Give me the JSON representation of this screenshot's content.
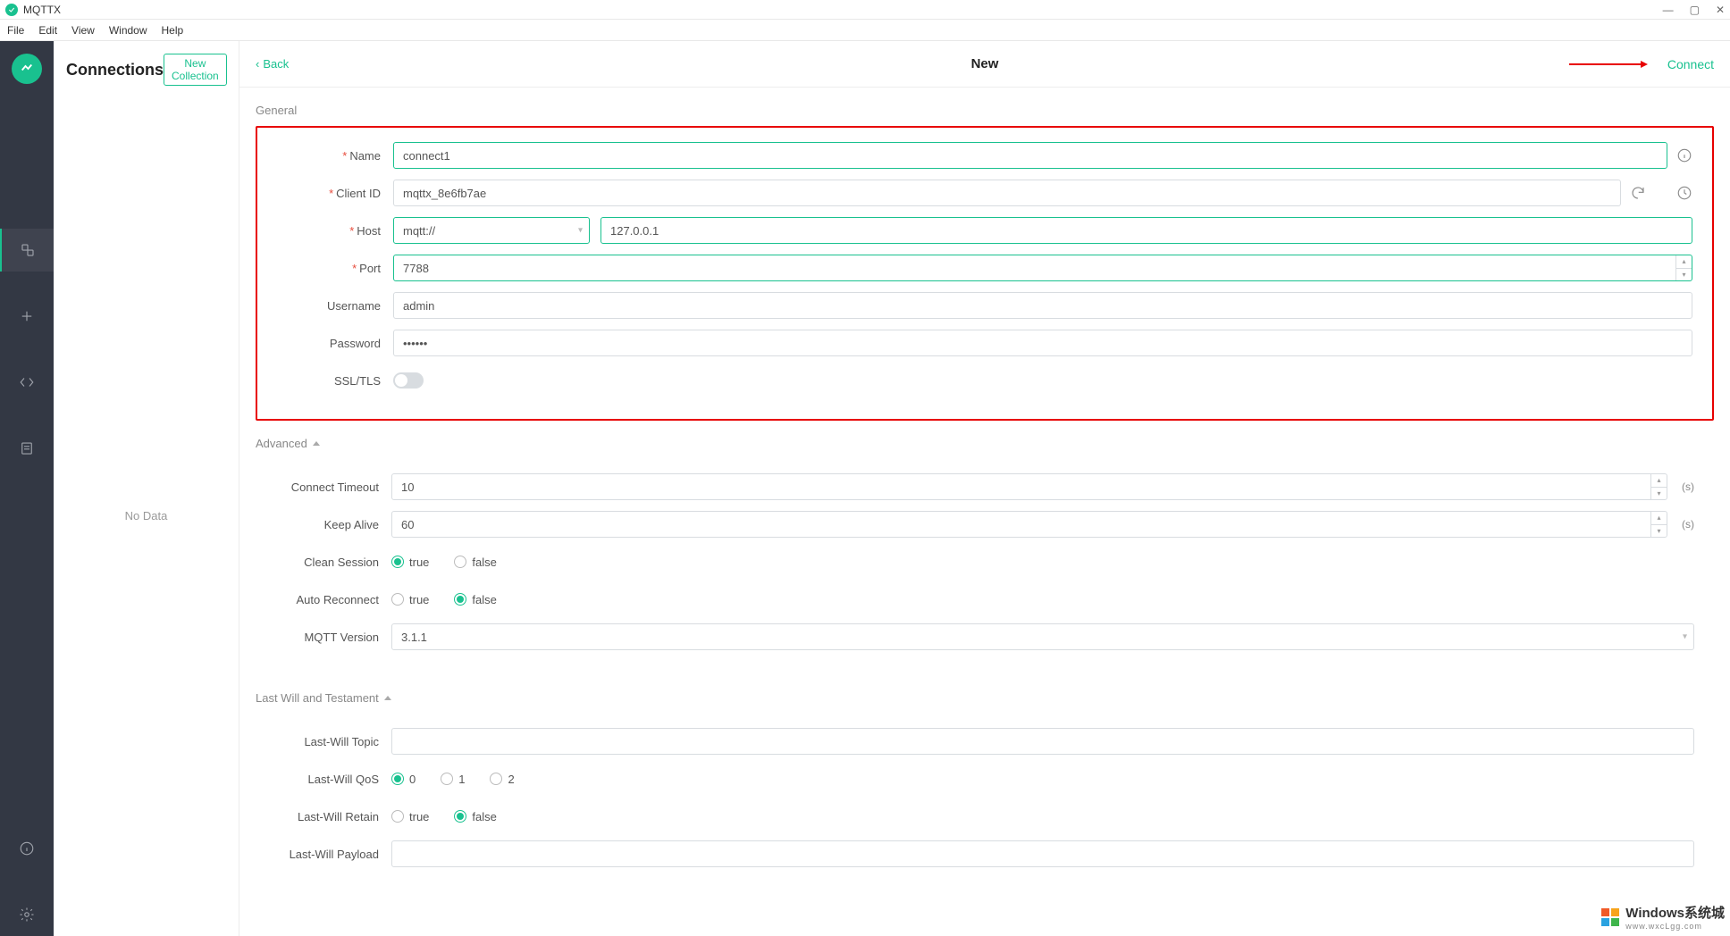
{
  "window": {
    "title": "MQTTX"
  },
  "menu": {
    "file": "File",
    "edit": "Edit",
    "view": "View",
    "window": "Window",
    "help": "Help"
  },
  "sidebar": {
    "title": "Connections",
    "new_collection": "New Collection",
    "no_data": "No Data"
  },
  "topbar": {
    "back": "Back",
    "title": "New",
    "connect": "Connect"
  },
  "general": {
    "section": "General",
    "name_label": "Name",
    "name_value": "connect1",
    "clientid_label": "Client ID",
    "clientid_value": "mqttx_8e6fb7ae",
    "host_label": "Host",
    "host_scheme": "mqtt://",
    "host_value": "127.0.0.1",
    "port_label": "Port",
    "port_value": "7788",
    "username_label": "Username",
    "username_value": "admin",
    "password_label": "Password",
    "password_value": "••••••",
    "ssltls_label": "SSL/TLS"
  },
  "advanced": {
    "section": "Advanced",
    "timeout_label": "Connect Timeout",
    "timeout_value": "10",
    "keepalive_label": "Keep Alive",
    "keepalive_value": "60",
    "unit_seconds": "(s)",
    "clean_label": "Clean Session",
    "auto_label": "Auto Reconnect",
    "true_label": "true",
    "false_label": "false",
    "mqttver_label": "MQTT Version",
    "mqttver_value": "3.1.1"
  },
  "lastwill": {
    "section": "Last Will and Testament",
    "topic_label": "Last-Will Topic",
    "topic_value": "",
    "qos_label": "Last-Will QoS",
    "qos_0": "0",
    "qos_1": "1",
    "qos_2": "2",
    "retain_label": "Last-Will Retain",
    "true_label": "true",
    "false_label": "false",
    "payload_label": "Last-Will Payload"
  },
  "watermark": {
    "text": "Windows系统城",
    "sub": "www.wxcLgg.com"
  }
}
